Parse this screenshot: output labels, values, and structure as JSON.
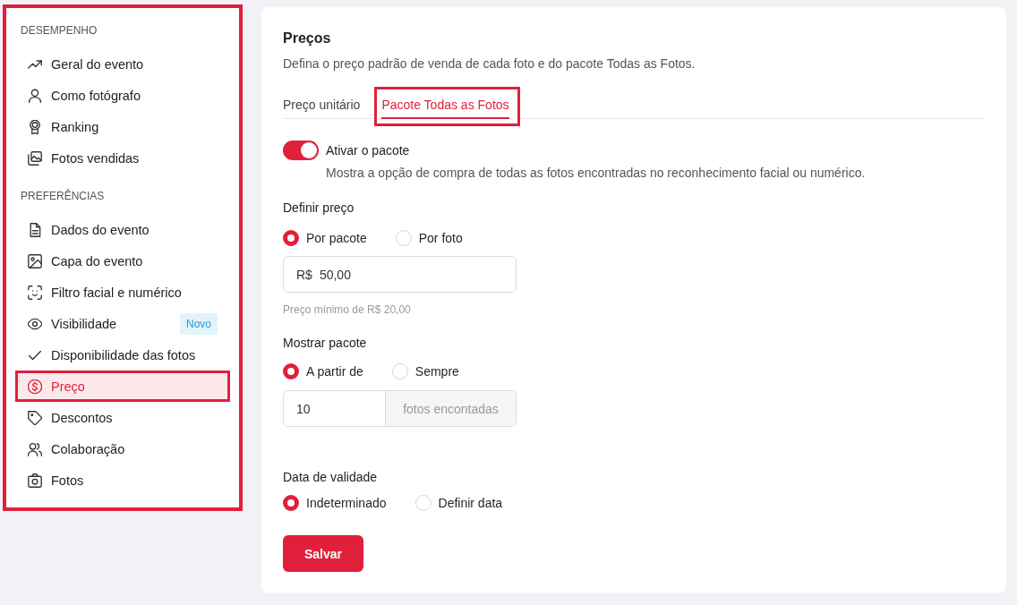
{
  "sidebar": {
    "highlighted": true,
    "sections": [
      {
        "title": "DESEMPENHO",
        "items": [
          {
            "label": "Geral do evento",
            "selected": false,
            "highlighted": false
          },
          {
            "label": "Como fotógrafo",
            "selected": false,
            "highlighted": false
          },
          {
            "label": "Ranking",
            "selected": false,
            "highlighted": false
          },
          {
            "label": "Fotos vendidas",
            "selected": false,
            "highlighted": false
          }
        ]
      },
      {
        "title": "PREFERÊNCIAS",
        "items": [
          {
            "label": "Dados do evento",
            "selected": false,
            "highlighted": false
          },
          {
            "label": "Capa do evento",
            "selected": false,
            "highlighted": false
          },
          {
            "label": "Filtro facial e numérico",
            "selected": false,
            "highlighted": false
          },
          {
            "label": "Visibilidade",
            "badge": "Novo",
            "selected": false,
            "highlighted": false
          },
          {
            "label": "Disponibilidade das fotos",
            "selected": false,
            "highlighted": false
          },
          {
            "label": "Preço",
            "selected": true,
            "highlighted": true
          },
          {
            "label": "Descontos",
            "selected": false,
            "highlighted": false
          },
          {
            "label": "Colaboração",
            "selected": false,
            "highlighted": false
          },
          {
            "label": "Fotos",
            "selected": false,
            "highlighted": false
          }
        ]
      }
    ]
  },
  "panel": {
    "title": "Preços",
    "description": "Defina o preço padrão de venda de cada foto e do pacote Todas as Fotos.",
    "tabs": [
      {
        "label": "Preço unitário",
        "selected": false,
        "highlighted": false
      },
      {
        "label": "Pacote Todas as Fotos",
        "selected": true,
        "highlighted": true
      }
    ],
    "package_toggle": {
      "label": "Ativar o pacote",
      "on": true,
      "description": "Mostra a opção de compra de todas as fotos encontradas no reconhecimento facial ou numérico."
    },
    "price_section": {
      "title": "Definir preço",
      "options": [
        {
          "label": "Por pacote",
          "selected": true
        },
        {
          "label": "Por foto",
          "selected": false
        }
      ],
      "price_input": {
        "prefix": "R$",
        "value": "50,00"
      },
      "hint": "Preço mínimo de R$ 20,00"
    },
    "show_section": {
      "title": "Mostrar pacote",
      "options": [
        {
          "label": "A partir de",
          "selected": true
        },
        {
          "label": "Sempre",
          "selected": false
        }
      ],
      "count_input": {
        "value": "10",
        "suffix": "fotos encontadas"
      }
    },
    "validity_section": {
      "title": "Data de validade",
      "options": [
        {
          "label": "Indeterminado",
          "selected": true
        },
        {
          "label": "Definir data",
          "selected": false
        }
      ]
    },
    "save_button": "Salvar"
  }
}
